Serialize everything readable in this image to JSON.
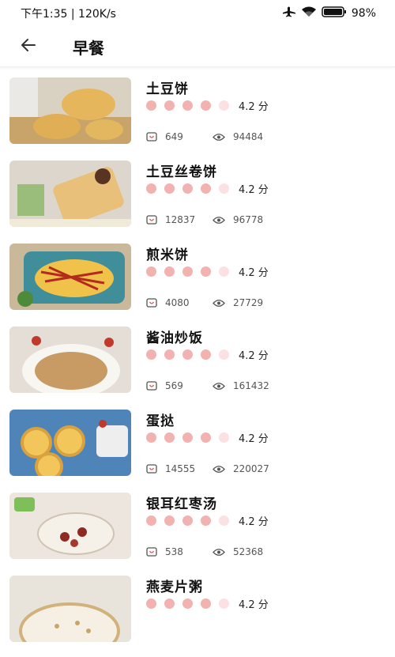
{
  "status_bar": {
    "time_speed": "下午1:35 | 120K/s",
    "battery": "98%"
  },
  "header": {
    "title": "早餐"
  },
  "recipes": [
    {
      "name": "土豆饼",
      "score": "4.2 分",
      "stars_filled": 4,
      "favorites": "649",
      "views": "94484"
    },
    {
      "name": "土豆丝卷饼",
      "score": "4.2 分",
      "stars_filled": 4,
      "favorites": "12837",
      "views": "96778"
    },
    {
      "name": "煎米饼",
      "score": "4.2 分",
      "stars_filled": 4,
      "favorites": "4080",
      "views": "27729"
    },
    {
      "name": "酱油炒饭",
      "score": "4.2 分",
      "stars_filled": 4,
      "favorites": "569",
      "views": "161432"
    },
    {
      "name": "蛋挞",
      "score": "4.2 分",
      "stars_filled": 4,
      "favorites": "14555",
      "views": "220027"
    },
    {
      "name": "银耳红枣汤",
      "score": "4.2 分",
      "stars_filled": 4,
      "favorites": "538",
      "views": "52368"
    },
    {
      "name": "燕麦片粥",
      "score": "4.2 分",
      "stars_filled": 4,
      "favorites": "",
      "views": ""
    }
  ],
  "colors": {
    "star_filled": "#f2b2b0",
    "star_empty": "#fbe1e1"
  },
  "icons": {
    "back": "arrow-left-icon",
    "favorite": "collect-icon",
    "views": "eye-icon"
  }
}
